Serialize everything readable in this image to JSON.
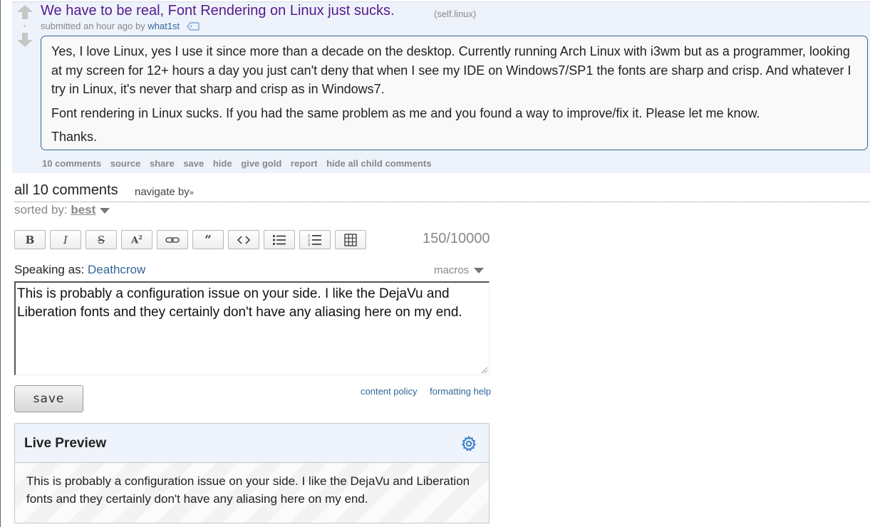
{
  "post": {
    "title": "We have to be real, Font Rendering on Linux just sucks.",
    "domain": "(self.linux)",
    "submitted_prefix": "submitted an hour ago by",
    "author": "what1st",
    "selftext": [
      "Yes, I love Linux, yes I use it since more than a decade on the desktop. Currently running Arch Linux with i3wm but as a programmer, looking at my screen for 12+ hours a day you just can't deny that when I see my IDE on Windows7/SP1 the fonts are sharp and crisp. And whatever I try in Linux, it's never that sharp and crisp as in Windows7.",
      "Font rendering in Linux sucks. If you had the same problem as me and you found a way to improve/fix it. Please let me know.",
      "Thanks."
    ],
    "buttons": [
      "10 comments",
      "source",
      "share",
      "save",
      "hide",
      "give gold",
      "report",
      "hide all child comments"
    ]
  },
  "comments_header": {
    "title": "all 10 comments",
    "navigate": "navigate by",
    "sorted_label": "sorted by:",
    "sorted_value": "best"
  },
  "editor": {
    "toolbar": [
      {
        "name": "bold-button",
        "glyph": "B"
      },
      {
        "name": "italic-button",
        "glyph": "I"
      },
      {
        "name": "strikethrough-button",
        "glyph": "S"
      },
      {
        "name": "superscript-button",
        "glyph": "A²"
      },
      {
        "name": "link-button",
        "glyph": "link"
      },
      {
        "name": "quote-button",
        "glyph": "quote"
      },
      {
        "name": "code-button",
        "glyph": "code"
      },
      {
        "name": "bullet-list-button",
        "glyph": "ul"
      },
      {
        "name": "numbered-list-button",
        "glyph": "ol"
      },
      {
        "name": "table-button",
        "glyph": "table"
      }
    ],
    "char_count": "150/10000",
    "speaking_label": "Speaking as:",
    "username": "Deathcrow",
    "macros_label": "macros",
    "comment_text": "This is probably a configuration issue on your side. I like the DejaVu and Liberation fonts and they certainly don't have any aliasing here on my end.",
    "save_label": "save",
    "content_policy": "content policy",
    "formatting_help": "formatting help"
  },
  "preview": {
    "title": "Live Preview",
    "text": "This is probably a configuration issue on your side. I like the DejaVu and Liberation fonts and they certainly don't have any aliasing here on my end."
  },
  "colors": {
    "title_visited": "#551a8b",
    "link_blue": "#336699",
    "post_bg": "#eef3fb"
  }
}
